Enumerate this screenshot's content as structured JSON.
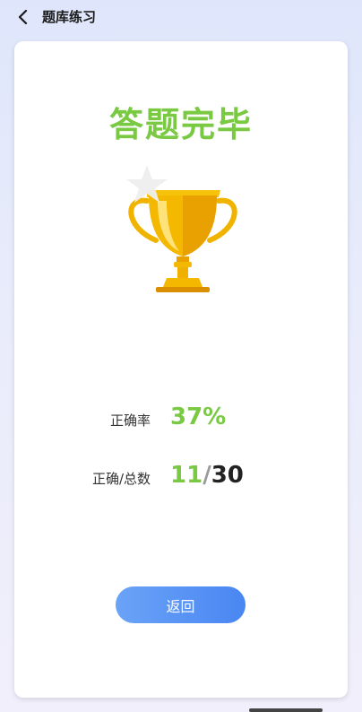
{
  "header": {
    "title": "题库练习",
    "back_icon": "chevron-left-icon"
  },
  "result": {
    "heading": "答题完毕",
    "trophy_icon": "trophy-icon",
    "accuracy_label": "正确率",
    "accuracy_value": "37%",
    "correct_total_label": "正确/总数",
    "correct": "11",
    "separator": "/",
    "total": "30",
    "return_label": "返回"
  },
  "colors": {
    "accent_green": "#7ac943",
    "button_blue": "#4a86f2",
    "trophy_gold": "#f5b800"
  }
}
